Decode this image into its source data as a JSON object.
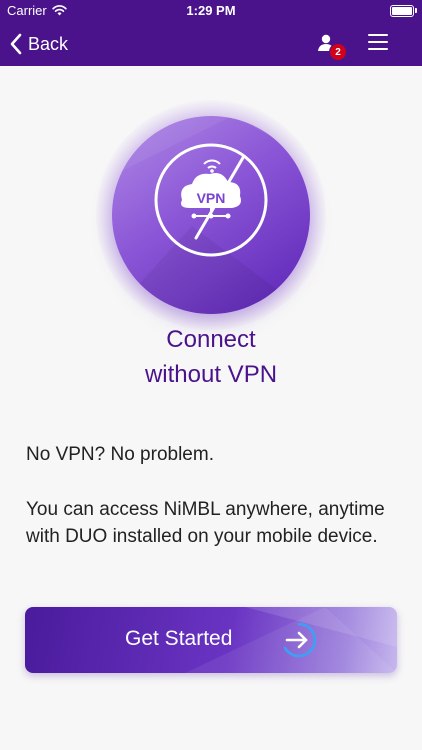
{
  "status_bar": {
    "carrier": "Carrier",
    "time": "1:29 PM"
  },
  "nav": {
    "back_label": "Back",
    "notification_count": "2"
  },
  "hero": {
    "icon_text": "VPN",
    "title_line1": "Connect",
    "title_line2": "without VPN"
  },
  "content": {
    "intro": "No VPN? No problem.",
    "body": "You can access NiMBL anywhere, anytime with DUO installed on your mobile device."
  },
  "cta": {
    "label": "Get Started"
  },
  "colors": {
    "brand": "#4a138c",
    "accent": "#7a43cf",
    "badge": "#d0021b",
    "cta_arrow_ring": "#3da0f5"
  },
  "icons": [
    "wifi-icon",
    "battery-icon",
    "chevron-left-icon",
    "user-icon",
    "menu-icon",
    "cloud-vpn-icon",
    "no-vpn-slash-icon",
    "arrow-right-icon"
  ]
}
